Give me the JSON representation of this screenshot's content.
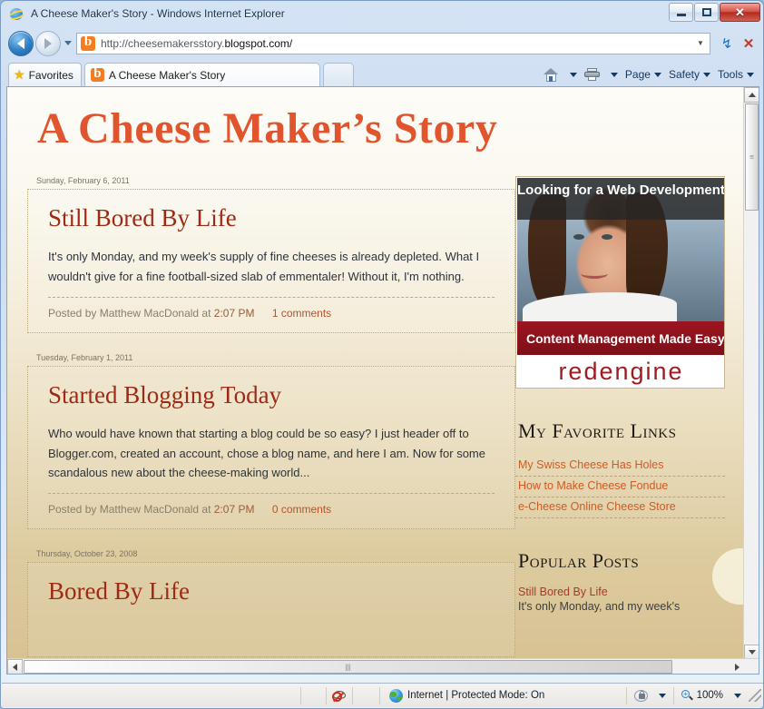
{
  "window": {
    "title": "A Cheese Maker's Story - Windows Internet Explorer",
    "minimize_label": "Minimize",
    "maximize_label": "Restore",
    "close_label": "✕"
  },
  "toolbar": {
    "back_label": "Back",
    "forward_label": "Forward",
    "recent_pages_label": "Recent Pages",
    "url_prefix": "http://cheesemakersstory.",
    "url_domain": "blogspot.com/",
    "url_full": "http://cheesemakersstory.blogspot.com/",
    "refresh_label": "↯",
    "stop_label": "✕",
    "dropdown_label": "▼"
  },
  "tabs": {
    "favorites_label": "Favorites",
    "items": [
      {
        "label": "A Cheese Maker's Story",
        "active": true
      }
    ],
    "new_tab_label": ""
  },
  "commandbar": {
    "home_label": "Home",
    "print_label": "Print",
    "page_label": "Page",
    "safety_label": "Safety",
    "tools_label": "Tools"
  },
  "blog": {
    "title": "A Cheese Maker’s Story",
    "title_color": "#e0542e",
    "posts": [
      {
        "date": "Sunday, February 6, 2011",
        "title": "Still Bored By Life",
        "body": "It's only Monday, and my week's supply of fine cheeses is already depleted. What I wouldn't give for a fine football-sized slab of emmentaler! Without it, I'm nothing.",
        "posted_by": "Posted by Matthew MacDonald at",
        "time": "2:07 PM",
        "comments": "1 comments"
      },
      {
        "date": "Tuesday, February 1, 2011",
        "title": "Started Blogging Today",
        "body": "Who would have known that starting a blog could be so easy? I just header off to Blogger.com, created an account, chose a blog name, and here I am. Now for some scandalous new about the cheese-making world...",
        "posted_by": "Posted by Matthew MacDonald at",
        "time": "2:07 PM",
        "comments": "0 comments"
      },
      {
        "date": "Thursday, October 23, 2008",
        "title": "Bored By Life",
        "body": "",
        "posted_by": "",
        "time": "",
        "comments": ""
      }
    ]
  },
  "sidebar": {
    "ad": {
      "headline": "Looking for a Web Development Solution?",
      "band": "Content Management Made Easy",
      "logo": "redengine"
    },
    "links_heading": "My Favorite Links",
    "links": [
      "My Swiss Cheese Has Holes",
      "How to Make Cheese Fondue",
      "e-Cheese Online Cheese Store"
    ],
    "popular_heading": "Popular Posts",
    "popular": [
      {
        "title": "Still Bored By Life",
        "snippet": "It's only Monday, and my week's"
      }
    ]
  },
  "statusbar": {
    "zone": "Internet | Protected Mode: On",
    "zoom": "100%",
    "privacy_dropdown": "▼",
    "zoom_dropdown": "▼"
  }
}
